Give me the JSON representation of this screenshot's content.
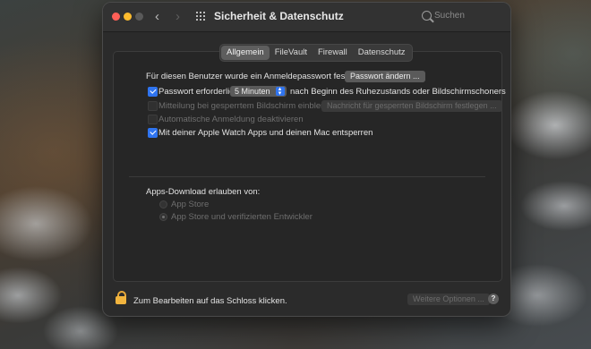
{
  "window": {
    "title": "Sicherheit & Datenschutz",
    "search_placeholder": "Suchen"
  },
  "tabs": [
    "Allgemein",
    "FileVault",
    "Firewall",
    "Datenschutz"
  ],
  "active_tab": "Allgemein",
  "general": {
    "login_password_text": "Für diesen Benutzer wurde ein Anmeldepasswort festgelegt",
    "change_password_button": "Passwort ändern ...",
    "require_password": {
      "label": "Passwort erforderlich",
      "checked": true,
      "select_value": "5 Minuten",
      "suffix": "nach Beginn des Ruhezustands oder Bildschirmschoners"
    },
    "lock_message": {
      "label": "Mitteilung bei gesperrtem Bildschirm einblenden",
      "checked": false,
      "enabled": false,
      "button": "Nachricht für gesperrten Bildschirm festlegen ..."
    },
    "auto_login": {
      "label": "Automatische Anmeldung deaktivieren",
      "checked": false,
      "enabled": false
    },
    "apple_watch": {
      "label": "Mit deiner Apple Watch Apps und deinen Mac entsperren",
      "checked": true
    }
  },
  "apps_download": {
    "heading": "Apps-Download erlauben von:",
    "options": [
      "App Store",
      "App Store und verifizierten Entwickler"
    ],
    "selected": "App Store und verifizierten Entwickler"
  },
  "footer": {
    "lock_text": "Zum Bearbeiten auf das Schloss klicken.",
    "advanced_button": "Weitere Optionen ...",
    "help": "?"
  },
  "colors": {
    "accent": "#2f74f0",
    "lock": "#f1b43e"
  }
}
